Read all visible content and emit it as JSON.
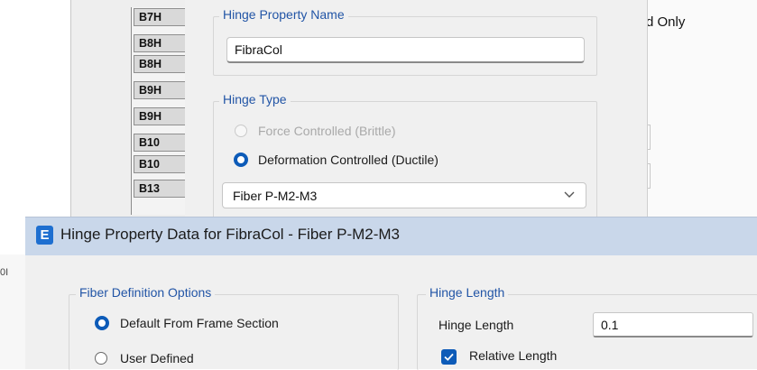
{
  "background_window": {
    "list_items": [
      "B7H",
      "B8H",
      "B8H",
      "B9H",
      "B9H",
      "B10",
      "B10",
      "B13"
    ],
    "right_label": "d Only",
    "left_edge_text": "0I"
  },
  "property_dialog": {
    "name_group_title": "Hinge Property Name",
    "name_value": "FibraCol",
    "type_group_title": "Hinge Type",
    "radio_force": "Force Controlled  (Brittle)",
    "radio_deformation": "Deformation Controlled  (Ductile)",
    "selected_type": "Fiber P-M2-M3"
  },
  "data_dialog": {
    "app_icon_letter": "E",
    "title": "Hinge Property Data for FibraCol - Fiber P-M2-M3",
    "fiber_group_title": "Fiber Definition Options",
    "option_default": "Default From Frame Section",
    "option_user": "User Defined",
    "length_group_title": "Hinge Length",
    "length_label": "Hinge Length",
    "length_value": "0.1",
    "relative_length_label": "Relative Length"
  },
  "colors": {
    "accent": "#0d5bb8",
    "group_title": "#2255a6",
    "titlebar": "#c9d7ea"
  }
}
